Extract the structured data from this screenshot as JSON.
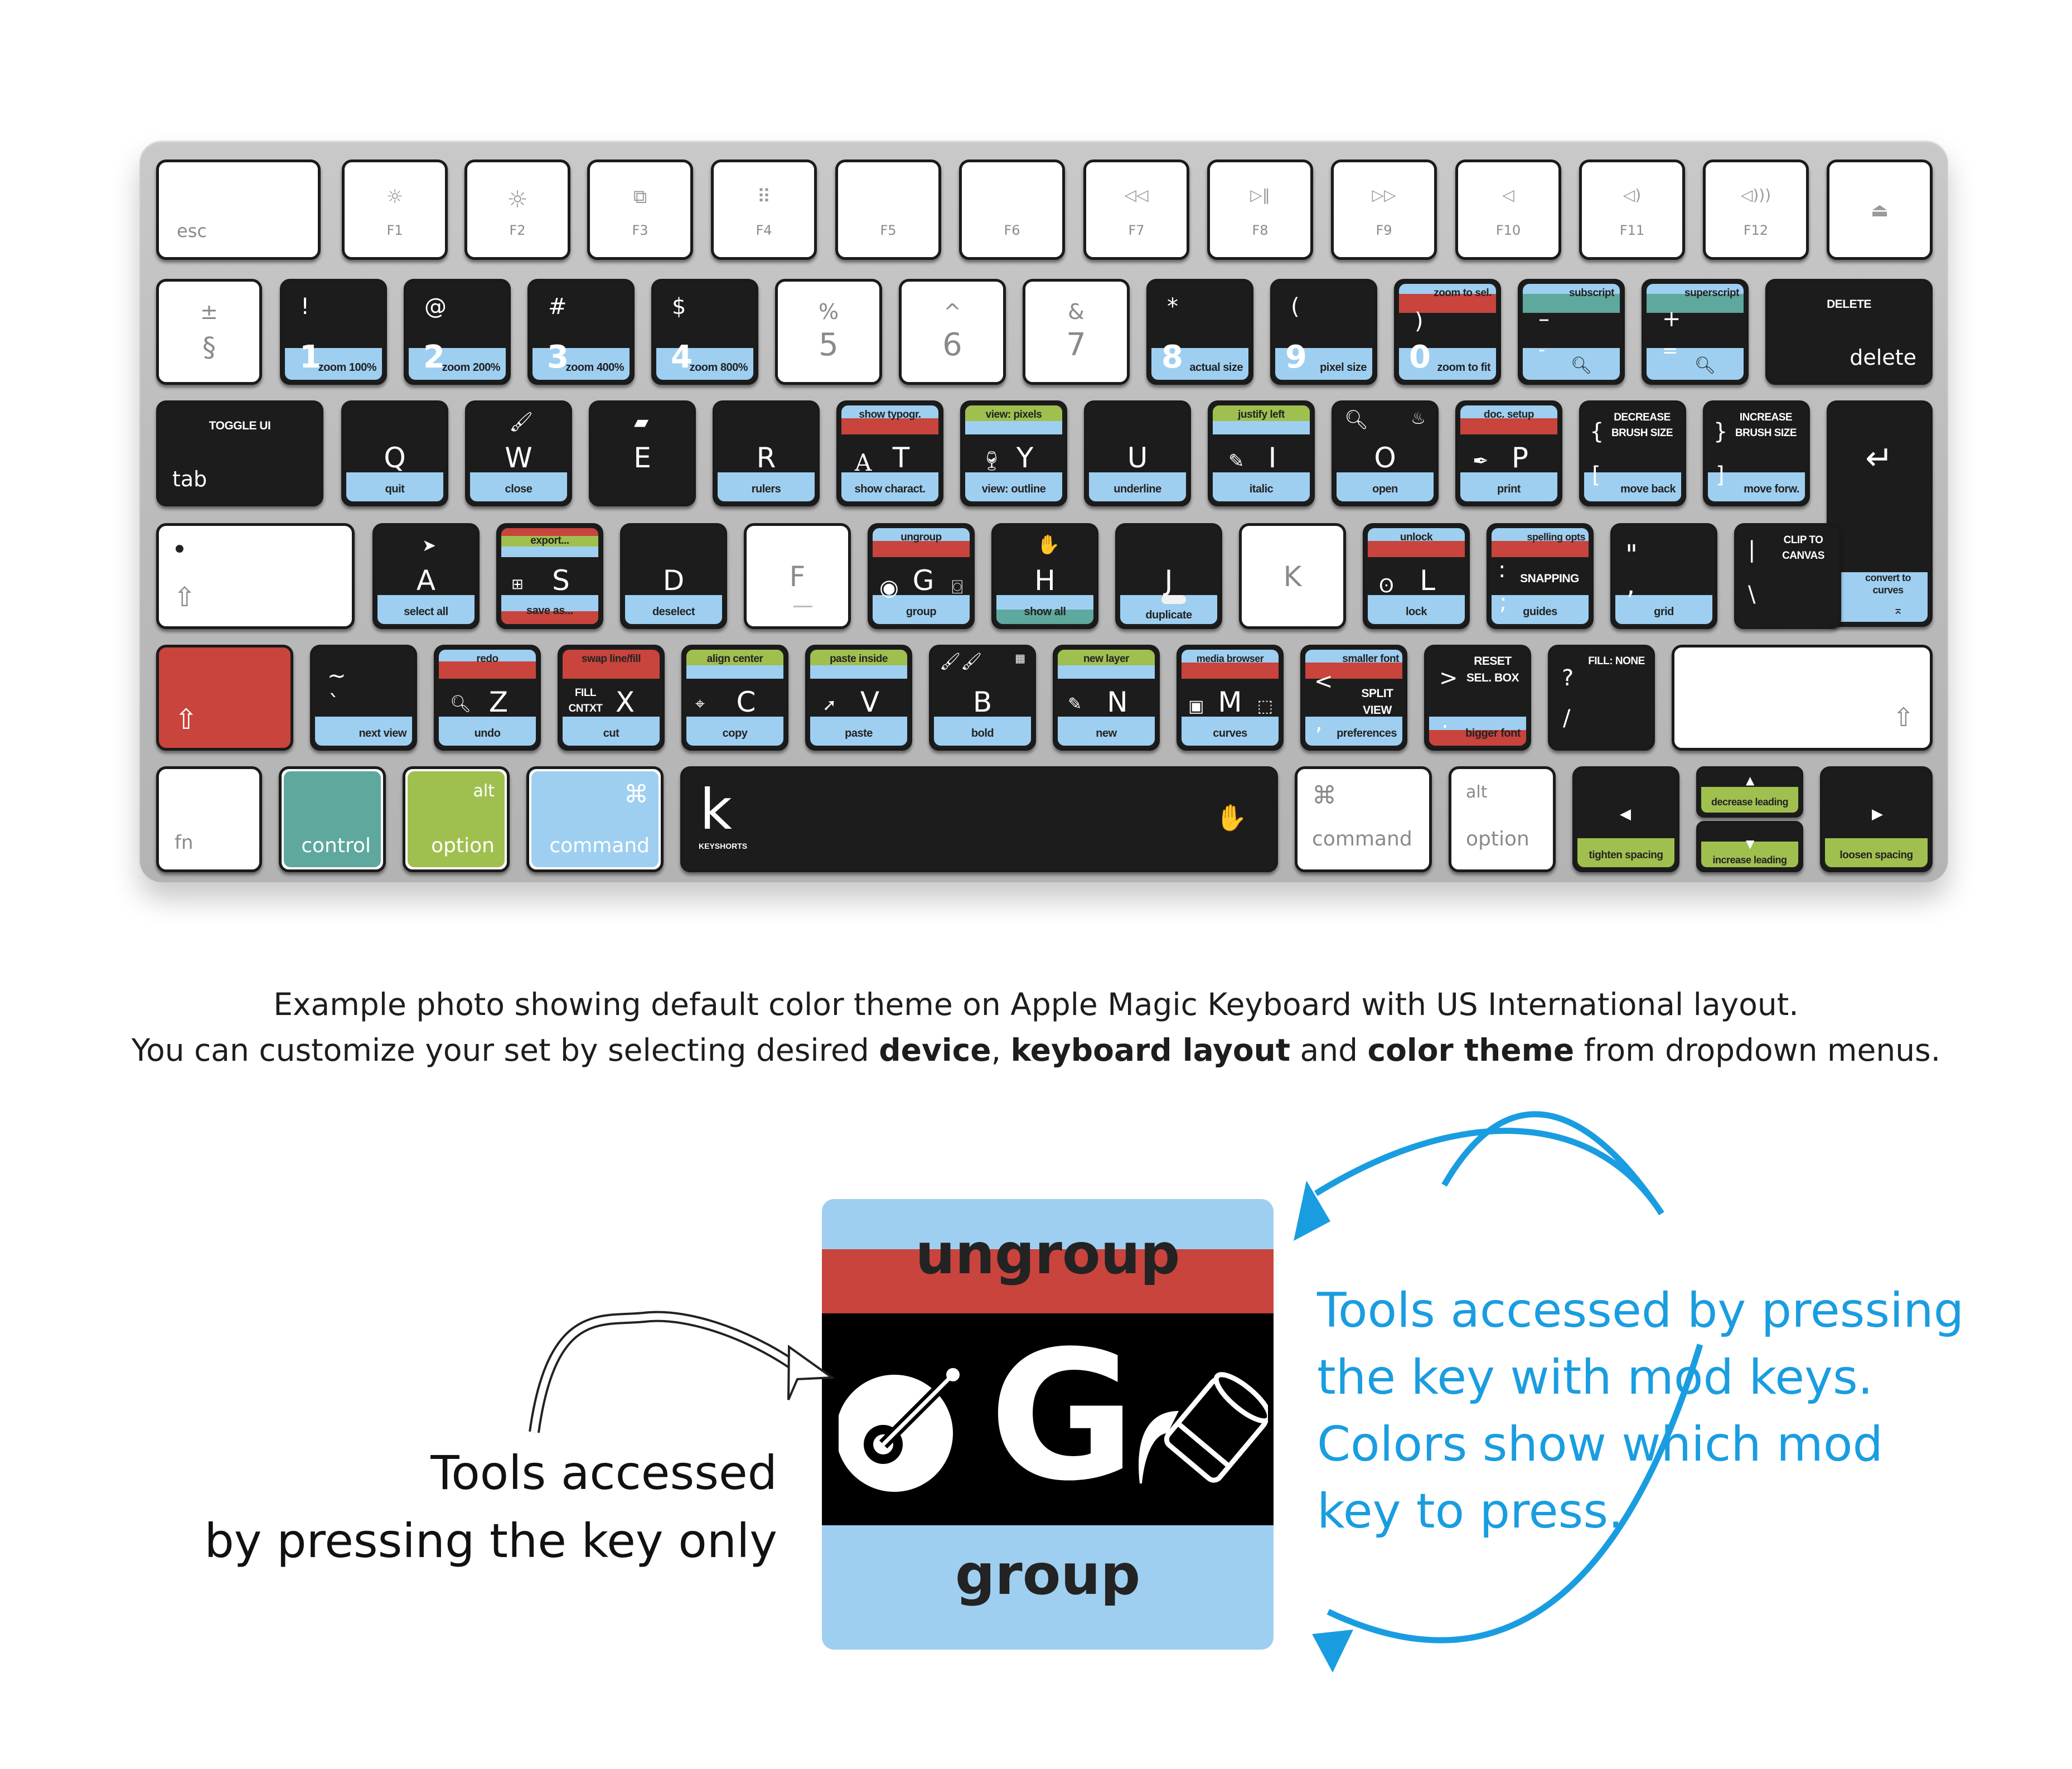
{
  "colors": {
    "command": "#9ecff1",
    "option": "#9fc04f",
    "control": "#5ea89e",
    "shift": "#c8443d",
    "key_black": "#1c1c1c",
    "annotation_blue": "#1a9de0"
  },
  "row_function": [
    {
      "id": "esc",
      "label": "esc",
      "icon": ""
    },
    {
      "id": "f1",
      "label": "F1",
      "icon": "brightness-down-icon"
    },
    {
      "id": "f2",
      "label": "F2",
      "icon": "brightness-up-icon"
    },
    {
      "id": "f3",
      "label": "F3",
      "icon": "mission-control-icon"
    },
    {
      "id": "f4",
      "label": "F4",
      "icon": "launchpad-icon"
    },
    {
      "id": "f5",
      "label": "F5",
      "icon": ""
    },
    {
      "id": "f6",
      "label": "F6",
      "icon": ""
    },
    {
      "id": "f7",
      "label": "F7",
      "icon": "rewind-icon"
    },
    {
      "id": "f8",
      "label": "F8",
      "icon": "play-pause-icon"
    },
    {
      "id": "f9",
      "label": "F9",
      "icon": "fast-forward-icon"
    },
    {
      "id": "f10",
      "label": "F10",
      "icon": "mute-icon"
    },
    {
      "id": "f11",
      "label": "F11",
      "icon": "volume-down-icon"
    },
    {
      "id": "f12",
      "label": "F12",
      "icon": "volume-up-icon"
    },
    {
      "id": "eject",
      "label": "",
      "icon": "eject-icon"
    }
  ],
  "glyphs": {
    "brightness": "☼",
    "mission": "⧉",
    "launchpad": "⠿",
    "rewind": "◁◁",
    "playpause": "▷‖",
    "ffwd": "▷▷",
    "mute": "◁",
    "voldown": "◁)",
    "volup": "◁)))",
    "eject": "⏏",
    "shift_arrow": "⇧",
    "return_arrow": "↵",
    "cmd": "⌘",
    "hand": "✋",
    "left_tri": "◀",
    "right_tri": "▶",
    "up_tri": "▲",
    "down_tri": "▼"
  },
  "row_number": {
    "section": {
      "top": "±",
      "bottom": "§"
    },
    "keys": [
      {
        "shift": "!",
        "num": "1",
        "bottom": "zoom 100%"
      },
      {
        "shift": "@",
        "num": "2",
        "bottom": "zoom 200%"
      },
      {
        "shift": "#",
        "num": "3",
        "bottom": "zoom 400%"
      },
      {
        "shift": "$",
        "num": "4",
        "bottom": "zoom 800%"
      }
    ],
    "plain": [
      {
        "shift": "%",
        "num": "5"
      },
      {
        "shift": "^",
        "num": "6"
      },
      {
        "shift": "&",
        "num": "7"
      }
    ],
    "keys2": [
      {
        "shift": "*",
        "num": "8",
        "bottom": "actual size",
        "top": ""
      },
      {
        "shift": "(",
        "num": "9",
        "bottom": "pixel size",
        "top": ""
      },
      {
        "shift": ")",
        "num": "0",
        "bottom": "zoom to fit",
        "top": "zoom to sel."
      },
      {
        "shift": "–",
        "num": "-",
        "bottom": "",
        "top": "subscript"
      },
      {
        "shift": "+",
        "num": "=",
        "bottom": "",
        "top": "superscript"
      }
    ],
    "delete": {
      "top": "DELETE",
      "bottom": "delete"
    }
  },
  "row_qwerty": {
    "tab": {
      "top": "TOGGLE UI",
      "bottom": "tab"
    },
    "keys": [
      {
        "letter": "Q",
        "top": "",
        "bottom": "quit"
      },
      {
        "letter": "W",
        "top": "",
        "bottom": "close"
      },
      {
        "letter": "E",
        "top": "",
        "bottom": ""
      },
      {
        "letter": "R",
        "top": "",
        "bottom": "rulers"
      },
      {
        "letter": "T",
        "top": "show typogr.",
        "bottom": "show charact."
      },
      {
        "letter": "Y",
        "top": "view: pixels",
        "bottom": "view: outline"
      },
      {
        "letter": "U",
        "top": "",
        "bottom": "underline"
      },
      {
        "letter": "I",
        "top": "justify left",
        "bottom": "italic"
      },
      {
        "letter": "O",
        "top": "",
        "bottom": "open"
      },
      {
        "letter": "P",
        "top": "doc. setup",
        "bottom": "print"
      }
    ],
    "bracket_left": {
      "glyph": "{",
      "glyph2": "[",
      "caps": "DECREASE BRUSH SIZE",
      "bottom": "move back"
    },
    "bracket_right": {
      "glyph": "}",
      "glyph2": "]",
      "caps": "INCREASE BRUSH SIZE",
      "bottom": "move forw."
    },
    "return": {
      "bottom": "convert to curves"
    }
  },
  "row_home": {
    "caps_lock": "",
    "keys": [
      {
        "letter": "A",
        "top": "",
        "bottom": "select all"
      },
      {
        "letter": "S",
        "top": "export...",
        "bottom": "save as..."
      },
      {
        "letter": "D",
        "top": "",
        "bottom": "deselect"
      },
      {
        "letter": "F",
        "top": "",
        "bottom": ""
      },
      {
        "letter": "G",
        "top": "ungroup",
        "bottom": "group"
      },
      {
        "letter": "H",
        "top": "",
        "bottom": "show all"
      },
      {
        "letter": "J",
        "top": "",
        "bottom": "duplicate"
      },
      {
        "letter": "K",
        "top": "",
        "bottom": ""
      },
      {
        "letter": "L",
        "top": "unlock",
        "bottom": "lock"
      }
    ],
    "semicolon": {
      "glyph": ":",
      "glyph2": ";",
      "caps": "SNAPPING",
      "top": "spelling opts",
      "bottom": "guides"
    },
    "quote": {
      "glyph": "\"",
      "glyph2": ",",
      "bottom": "grid"
    },
    "backslash": {
      "glyph": "|",
      "glyph2": "\\",
      "caps": "CLIP TO CANVAS"
    }
  },
  "row_bottom_letters": {
    "backtick": {
      "glyph": "~",
      "glyph2": "`",
      "bottom": "next view"
    },
    "keys": [
      {
        "letter": "Z",
        "top": "redo",
        "bottom": "undo"
      },
      {
        "letter": "X",
        "top": "swap line/fill",
        "bottom": "cut",
        "caps": "FILL CNTXT"
      },
      {
        "letter": "C",
        "top": "align center",
        "bottom": "copy"
      },
      {
        "letter": "V",
        "top": "paste inside",
        "bottom": "paste"
      },
      {
        "letter": "B",
        "top": "",
        "bottom": "bold"
      },
      {
        "letter": "N",
        "top": "new layer",
        "bottom": "new"
      },
      {
        "letter": "M",
        "top": "media browser",
        "bottom": "curves"
      }
    ],
    "comma": {
      "glyph": "<",
      "glyph2": ",",
      "caps": "SPLIT VIEW",
      "top": "smaller font",
      "bottom": "preferences"
    },
    "period": {
      "glyph": ">",
      "glyph2": ".",
      "caps": "RESET SEL. BOX",
      "bottom": "bigger font"
    },
    "slash": {
      "glyph": "?",
      "glyph2": "/",
      "caps": "FILL: NONE"
    }
  },
  "row_mods": {
    "fn": "fn",
    "control": "control",
    "option": {
      "top": "alt",
      "bottom": "option"
    },
    "command": {
      "top": "⌘",
      "bottom": "command"
    },
    "space": {
      "logo": "k",
      "brand": "KEYSHORTS"
    },
    "command_r": {
      "top": "⌘",
      "bottom": "command"
    },
    "option_r": {
      "top": "alt",
      "bottom": "option"
    },
    "left": {
      "bottom": "tighten spacing"
    },
    "up": {
      "bottom": "decrease leading"
    },
    "down": {
      "bottom": "increase leading"
    },
    "right": {
      "bottom": "loosen spacing"
    }
  },
  "caption": {
    "line1": "Example photo showing default color theme on Apple Magic Keyboard with US International layout.",
    "line2_a": "You can customize your set by selecting desired ",
    "line2_b": "device",
    "line2_c": ", ",
    "line2_d": "keyboard layout",
    "line2_e": " and ",
    "line2_f": "color theme",
    "line2_g": " from dropdown menus."
  },
  "explainer": {
    "big_key": {
      "top": "ungroup",
      "letter": "G",
      "bottom": "group"
    },
    "left_note": [
      "Tools accessed",
      "by pressing the key only"
    ],
    "right_note": [
      "Tools accessed by pressing",
      "the key with mod keys.",
      "Colors show which mod",
      "key to press."
    ]
  }
}
